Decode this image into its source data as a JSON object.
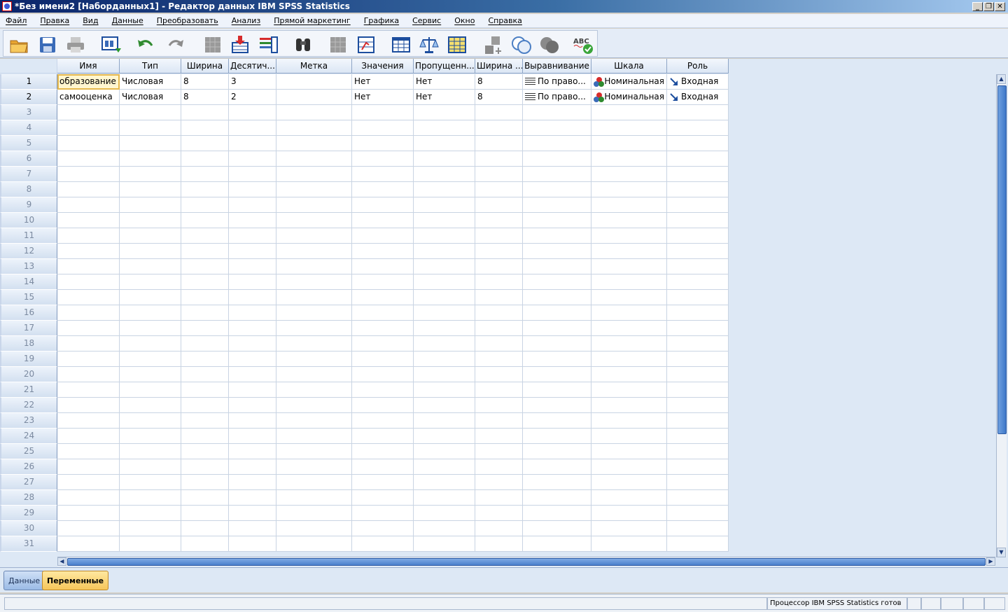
{
  "window": {
    "title": "*Без имени2 [Наборданных1] - Редактор данных IBM SPSS Statistics",
    "minimize": "_",
    "restore": "❐",
    "close": "✕"
  },
  "menu": [
    "Файл",
    "Правка",
    "Вид",
    "Данные",
    "Преобразовать",
    "Анализ",
    "Прямой маркетинг",
    "Графика",
    "Сервис",
    "Окно",
    "Справка"
  ],
  "toolbar": {
    "buttons": [
      "open-icon",
      "save-icon",
      "print-icon",
      "dialog-recall-icon",
      "undo-icon",
      "redo-icon",
      "goto-case-icon",
      "goto-variable-icon",
      "variables-icon",
      "find-icon",
      "insert-cases-icon",
      "insert-variable-icon",
      "split-file-icon",
      "weight-cases-icon",
      "select-cases-icon",
      "value-labels-icon",
      "use-sets-icon",
      "show-all-variables-icon",
      "spell-check-icon"
    ],
    "spell_label": "ABC"
  },
  "grid": {
    "headers": [
      "Имя",
      "Тип",
      "Ширина",
      "Десятич...",
      "Метка",
      "Значения",
      "Пропущенн...",
      "Ширина ...",
      "Выравнивание",
      "Шкала",
      "Роль"
    ],
    "rows": [
      {
        "num": "1",
        "name": "образование",
        "type": "Числовая",
        "width": "8",
        "decimals": "3",
        "label": "",
        "values": "Нет",
        "missing": "Нет",
        "columns": "8",
        "align": "По право...",
        "measure": "Номинальная",
        "role": "Входная"
      },
      {
        "num": "2",
        "name": "самооценка",
        "type": "Числовая",
        "width": "8",
        "decimals": "2",
        "label": "",
        "values": "Нет",
        "missing": "Нет",
        "columns": "8",
        "align": "По право...",
        "measure": "Номинальная",
        "role": "Входная"
      }
    ],
    "empty_row_numbers": [
      "3",
      "4",
      "5",
      "6",
      "7",
      "8",
      "9",
      "10",
      "11",
      "12",
      "13",
      "14",
      "15",
      "16",
      "17",
      "18",
      "19",
      "20",
      "21",
      "22",
      "23",
      "24",
      "25",
      "26",
      "27",
      "28",
      "29",
      "30",
      "31"
    ]
  },
  "tabs": {
    "data": "Данные",
    "variables": "Переменные"
  },
  "status": {
    "processor": "Процессор IBM SPSS Statistics  готов"
  },
  "colors": {
    "accent": "#0a246a",
    "selected_tab": "#f6c65a",
    "selected_cell": "#e6b84d"
  }
}
